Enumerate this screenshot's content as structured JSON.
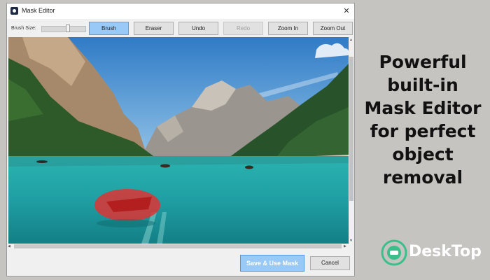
{
  "window": {
    "title": "Mask Editor",
    "close_glyph": "✕",
    "app_icon": "mask-editor-app-icon"
  },
  "toolbar": {
    "brush_size_label": "Brush Size:",
    "brush_size_level": 0.6,
    "buttons": {
      "brush": "Brush",
      "eraser": "Eraser",
      "undo": "Undo",
      "redo": "Redo",
      "zoom_in": "Zoom In",
      "zoom_out": "Zoom Out"
    },
    "active_tool": "Brush",
    "disabled": [
      "Redo"
    ]
  },
  "footer": {
    "save_label": "Save & Use Mask",
    "cancel_label": "Cancel"
  },
  "promo": {
    "lines": [
      "Powerful",
      "built-in",
      "Mask Editor",
      "for perfect",
      "object",
      "removal"
    ]
  },
  "logo": {
    "text": "DeskTop",
    "icon": "desktop-logo-icon"
  },
  "colors": {
    "accent": "#99c9f7",
    "mask": "#e53030",
    "page_background": "#c6c4c1",
    "logo_green": "#3bbf8a"
  }
}
